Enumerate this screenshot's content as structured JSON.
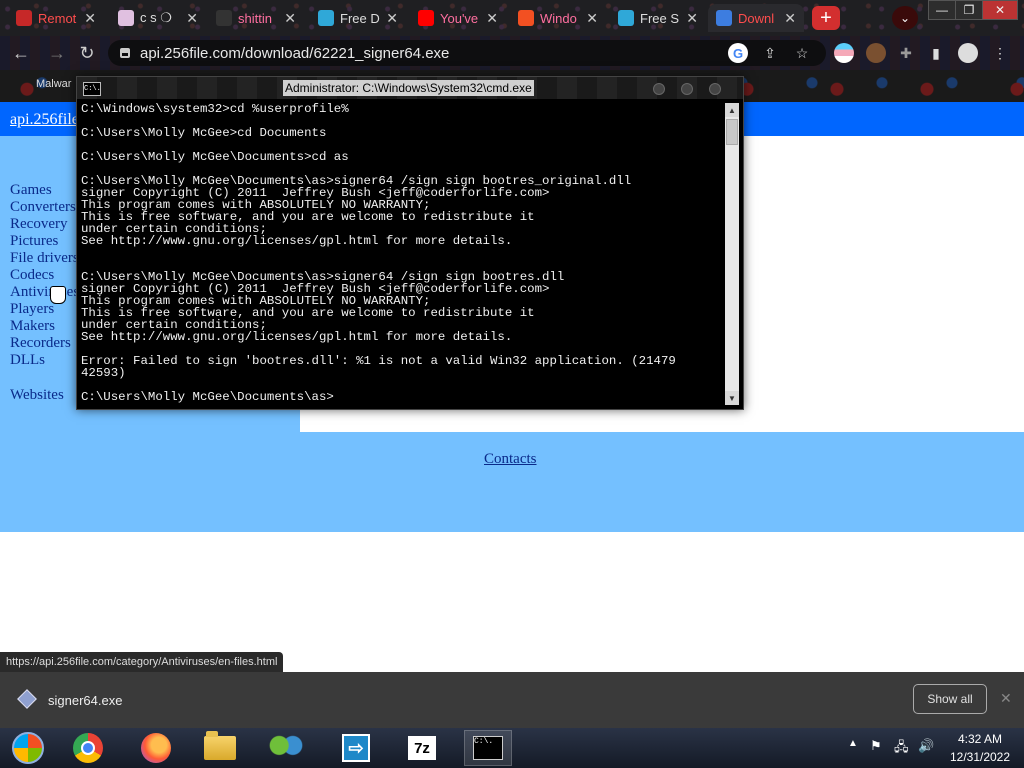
{
  "browser": {
    "tabs": [
      {
        "label": "Remot",
        "style": "red",
        "favicon": "#c62828"
      },
      {
        "label": "c s ❍",
        "style": "normal",
        "favicon": "#e0c0e0"
      },
      {
        "label": "shittin",
        "style": "pink",
        "favicon": "#333333"
      },
      {
        "label": "Free D",
        "style": "normal",
        "favicon": "#2fa8d8"
      },
      {
        "label": "You've",
        "style": "pink",
        "favicon": "#ff0000"
      },
      {
        "label": "Windo",
        "style": "pink",
        "favicon": "#f25022"
      },
      {
        "label": "Free S",
        "style": "normal",
        "favicon": "#2fa8d8"
      },
      {
        "label": "Downl",
        "style": "red",
        "favicon": "#3d7de0"
      }
    ],
    "new_tab_symbol": "+",
    "tab_menu_symbol": "⌄",
    "window_controls": [
      "—",
      "❐",
      "✕"
    ],
    "url": "api.256file.com/download/62221_signer64.exe",
    "bookmark_label": "Malwar",
    "status_url": "https://api.256file.com/category/Antiviruses/en-files.html"
  },
  "page": {
    "site_link": "api.256file",
    "sidebar": [
      "Games",
      "Converters",
      "Recovery",
      "Pictures",
      "File drivers",
      "Codecs",
      "Antiviruses",
      "Players",
      "Makers",
      "Recorders",
      "DLLs"
    ],
    "websites": "Websites",
    "contacts": "Contacts"
  },
  "cmd": {
    "title": "Administrator: C:\\Windows\\System32\\cmd.exe",
    "icon_text": "C:\\.",
    "lines": [
      "C:\\Windows\\system32>cd %userprofile%",
      "",
      "C:\\Users\\Molly McGee>cd Documents",
      "",
      "C:\\Users\\Molly McGee\\Documents>cd as",
      "",
      "C:\\Users\\Molly McGee\\Documents\\as>signer64 /sign sign bootres_original.dll",
      "signer Copyright (C) 2011  Jeffrey Bush <jeff@coderforlife.com>",
      "This program comes with ABSOLUTELY NO WARRANTY;",
      "This is free software, and you are welcome to redistribute it",
      "under certain conditions;",
      "See http://www.gnu.org/licenses/gpl.html for more details.",
      "",
      "",
      "C:\\Users\\Molly McGee\\Documents\\as>signer64 /sign sign bootres.dll",
      "signer Copyright (C) 2011  Jeffrey Bush <jeff@coderforlife.com>",
      "This program comes with ABSOLUTELY NO WARRANTY;",
      "This is free software, and you are welcome to redistribute it",
      "under certain conditions;",
      "See http://www.gnu.org/licenses/gpl.html for more details.",
      "",
      "Error: Failed to sign 'bootres.dll': %1 is not a valid Win32 application. (21479",
      "42593)",
      "",
      "C:\\Users\\Molly McGee\\Documents\\as>"
    ]
  },
  "downloads": {
    "file_name": "signer64.exe",
    "show_all": "Show all"
  },
  "taskbar": {
    "time": "4:32 AM",
    "date": "12/31/2022",
    "seven_zip_label": "7z",
    "cmd_icon_text": "C:\\."
  }
}
